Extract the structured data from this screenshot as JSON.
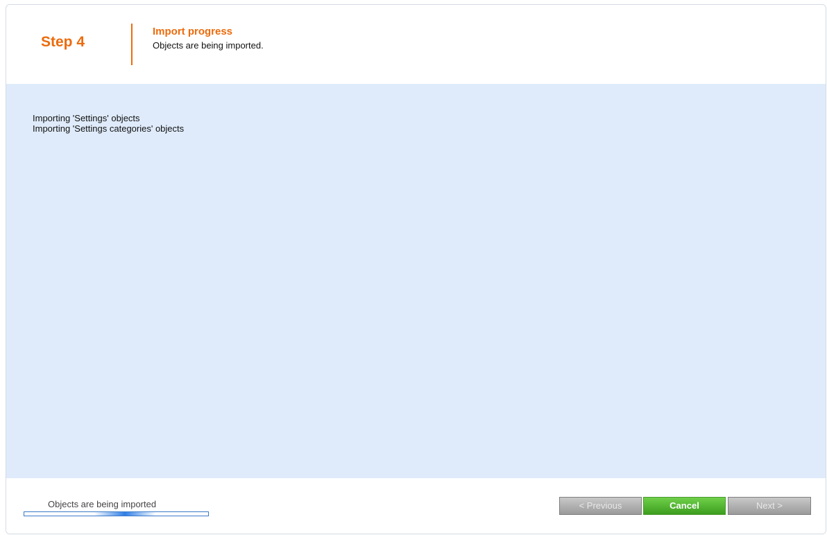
{
  "header": {
    "step": "Step 4",
    "title": "Import progress",
    "description": "Objects are being imported."
  },
  "log": {
    "lines": [
      "Importing 'Settings' objects",
      "Importing 'Settings categories' objects"
    ]
  },
  "footer": {
    "progress_text": "Objects are being imported",
    "buttons": {
      "previous": "< Previous",
      "cancel": "Cancel",
      "next": "Next >"
    }
  },
  "colors": {
    "accent": "#ec6b0c",
    "content_bg": "#dfebfb",
    "cancel_green": "#4cb52a",
    "disabled_gray": "#a8a8a8",
    "progress_blue": "#2f7fe6"
  }
}
